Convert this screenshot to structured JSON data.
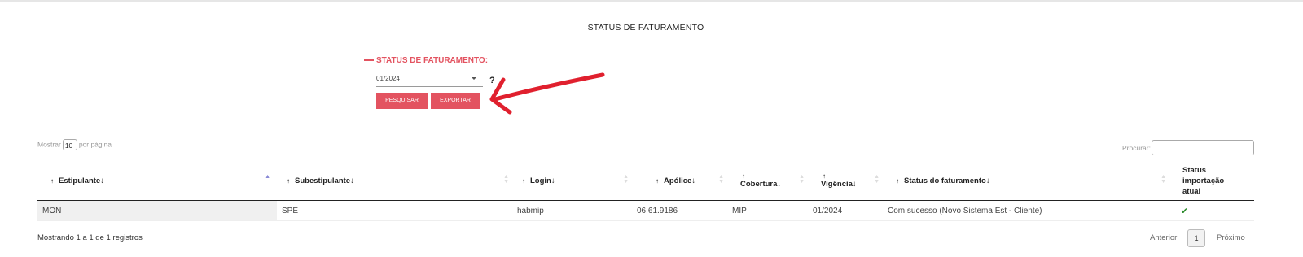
{
  "page": {
    "title": "STATUS DE FATURAMENTO"
  },
  "filter": {
    "section_title": "STATUS DE FATURAMENTO:",
    "period_value": "01/2024",
    "help": "?",
    "search_button": "PESQUISAR",
    "export_button": "EXPORTAR"
  },
  "table_controls": {
    "show_prefix": "Mostrar",
    "page_length": "10",
    "show_suffix": "por página",
    "search_label": "Procurar:"
  },
  "table": {
    "headers": [
      "Estipulante",
      "Subestipulante",
      "Login",
      "Apólice",
      "Cobertura",
      "Vigência",
      "Status do faturamento",
      "Status importação atual"
    ],
    "rows": [
      [
        "MON",
        "SPE",
        "habmip",
        "06.61.9186",
        "MIP",
        "01/2024",
        "Com sucesso (Novo Sistema Est - Cliente)"
      ]
    ]
  },
  "footer": {
    "info": "Mostrando 1 a 1 de 1 registros",
    "prev": "Anterior",
    "page": "1",
    "next": "Próximo"
  },
  "colors": {
    "accent": "#e35360",
    "success": "#2a8a2a"
  }
}
